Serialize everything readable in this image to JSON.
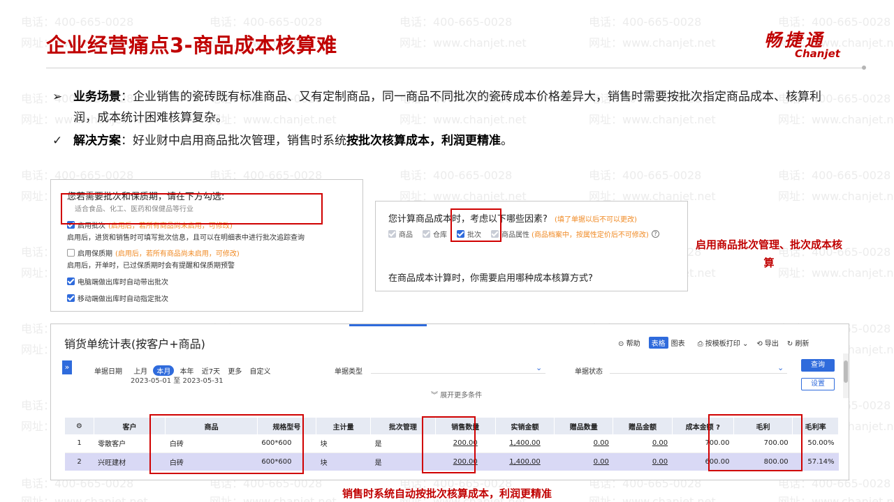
{
  "watermark": {
    "phone": "电话：400-665-0028",
    "site": "网址：www.chanjet.net"
  },
  "header": {
    "title": "企业经营痛点3-商品成本核算难",
    "logo_cn": "畅捷通",
    "logo_en": "Chanjet"
  },
  "bullets": {
    "scene_marker": "➢",
    "scene_label": "业务场景",
    "scene_text": "：企业销售的瓷砖既有标准商品、又有定制商品，同一商品不同批次的瓷砖成本价格差异大，销售时需要按批次指定商品成本、核算利润，成本统计困难核算复杂。",
    "solution_marker": "✓",
    "solution_label": "解决方案",
    "solution_text": "：好业财中启用商品批次管理，销售时系统",
    "solution_strong": "按批次核算成本，利润更精准",
    "solution_end": "。"
  },
  "panel1": {
    "heading": "您若需要批次和保质期，请在下方勾选:",
    "subheading": "适合食品、化工、医药和保健品等行业",
    "batch_label": "启用批次",
    "batch_note": "(启用后，若所有商品尚未启用，可修改)",
    "batch_desc": "启用后，进货和销售时可填写批次信息，且可以在明细表中进行批次追踪查询",
    "shelf_label": "启用保质期",
    "shelf_note": "(启用后，若所有商品尚未启用，可修改)",
    "shelf_desc": "启用后，开单时，已过保质期时会有提醒和保质期预警",
    "pc_auto": "电脑端做出库时自动带出批次",
    "mobile_auto": "移动端做出库时自动指定批次"
  },
  "panel2": {
    "question1": "您计算商品成本时，考虑以下哪些因素?",
    "question1_note": "(填了单据以后不可以更改)",
    "opt_goods": "商品",
    "opt_warehouse": "仓库",
    "opt_batch": "批次",
    "opt_attr": "商品属性",
    "opt_attr_note": "(商品档案中，按属性定价后不可修改)",
    "question2": "在商品成本计算时，你需要启用哪种成本核算方式?"
  },
  "note1": "启用商品批次管理、批次成本核算",
  "report": {
    "title": "销货单统计表(按客户+商品)",
    "help": "帮助",
    "view_table": "表格",
    "view_chart": "图表",
    "print": "按模板打印",
    "export": "导出",
    "refresh": "刷新",
    "date_label": "单据日期",
    "date_options": [
      "上月",
      "本月",
      "本年",
      "近7天",
      "更多",
      "自定义"
    ],
    "date_range": "2023-05-01 至 2023-05-31",
    "doc_type_label": "单据类型",
    "doc_status_label": "单据状态",
    "query_btn": "查询",
    "settings_btn": "设置",
    "expand": "展开更多条件",
    "columns": [
      "客户",
      "商品",
      "规格型号",
      "主计量",
      "批次管理",
      "销售数量",
      "实销金额",
      "赠品数量",
      "赠品金额",
      "成本金额",
      "毛利",
      "毛利率"
    ],
    "rows": [
      {
        "no": "1",
        "customer": "零散客户",
        "goods": "白砖",
        "spec": "600*600",
        "unit": "块",
        "batch": "是",
        "qty": "200.00",
        "amount": "1,400.00",
        "gift_qty": "0.00",
        "gift_amt": "0.00",
        "cost": "700.00",
        "profit": "700.00",
        "margin": "50.00%"
      },
      {
        "no": "2",
        "customer": "兴旺建材",
        "goods": "白砖",
        "spec": "600*600",
        "unit": "块",
        "batch": "是",
        "qty": "200.00",
        "amount": "1,400.00",
        "gift_qty": "0.00",
        "gift_amt": "0.00",
        "cost": "600.00",
        "profit": "800.00",
        "margin": "57.14%"
      }
    ]
  },
  "note2": "销售时系统自动按批次核算成本，利润更精准"
}
